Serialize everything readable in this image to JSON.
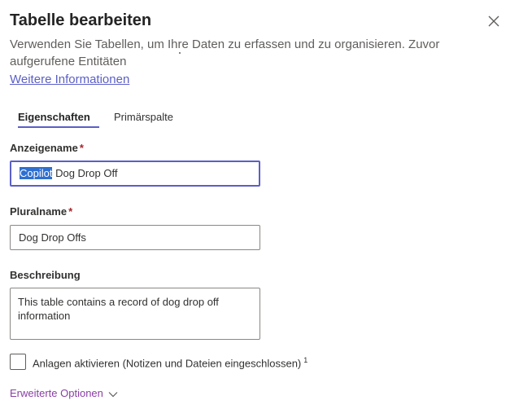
{
  "panel": {
    "title": "Tabelle bearbeiten",
    "description": "Verwenden Sie Tabellen, um Ihre Daten zu erfassen und zu organisieren. Zuvor aufgerufene Entitäten",
    "more_info_link": "Weitere Informationen"
  },
  "tabs": [
    {
      "label": "Eigenschaften",
      "active": true
    },
    {
      "label": "Primärspalte",
      "active": false
    }
  ],
  "form": {
    "display_name": {
      "label": "Anzeigename",
      "required_mark": "*",
      "value_selected": "Copilot",
      "value_rest": " Dog Drop Off"
    },
    "plural_name": {
      "label": "Pluralname",
      "required_mark": "*",
      "value": "Dog Drop Offs"
    },
    "description": {
      "label": "Beschreibung",
      "value": "This table contains a record of dog drop off information"
    },
    "attachments": {
      "label": "Anlagen aktivieren (Notizen und Dateien eingeschlossen)",
      "footnote": "1",
      "checked": false
    }
  },
  "advanced_options": {
    "label": "Erweiterte Optionen"
  },
  "colors": {
    "accent": "#5b5fc7",
    "selection": "#2f6fd0",
    "required": "#a4262c",
    "advanced_link": "#8a3ea6"
  },
  "icons": {
    "close": "close-icon",
    "expand": "chevron-down-icon"
  }
}
